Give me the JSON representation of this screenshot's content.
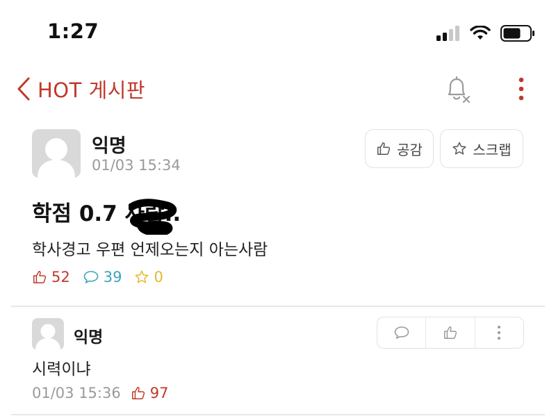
{
  "status_bar": {
    "time": "1:27"
  },
  "nav": {
    "title": "HOT 게시판"
  },
  "post": {
    "author": "익명",
    "timestamp": "01/03 15:34",
    "like_button_label": "공감",
    "scrap_button_label": "스크랩",
    "title": "학점 0.7 사람..",
    "body": "학사경고 우편 언제오는지 아는사람",
    "stats": {
      "likes": "52",
      "comments": "39",
      "scraps": "0"
    }
  },
  "comments": [
    {
      "author": "익명",
      "body": "시력이냐",
      "timestamp": "01/03 15:36",
      "likes": "97"
    }
  ],
  "colors": {
    "accent": "#c0392b",
    "comment": "#3aa5b8",
    "scrap": "#e5b82a",
    "muted": "#9a9a9a"
  },
  "icons": [
    "back-chevron-icon",
    "bell-off-icon",
    "more-vertical-icon",
    "thumbs-up-icon",
    "star-icon",
    "speech-bubble-icon",
    "signal-icon",
    "wifi-icon",
    "battery-icon"
  ]
}
